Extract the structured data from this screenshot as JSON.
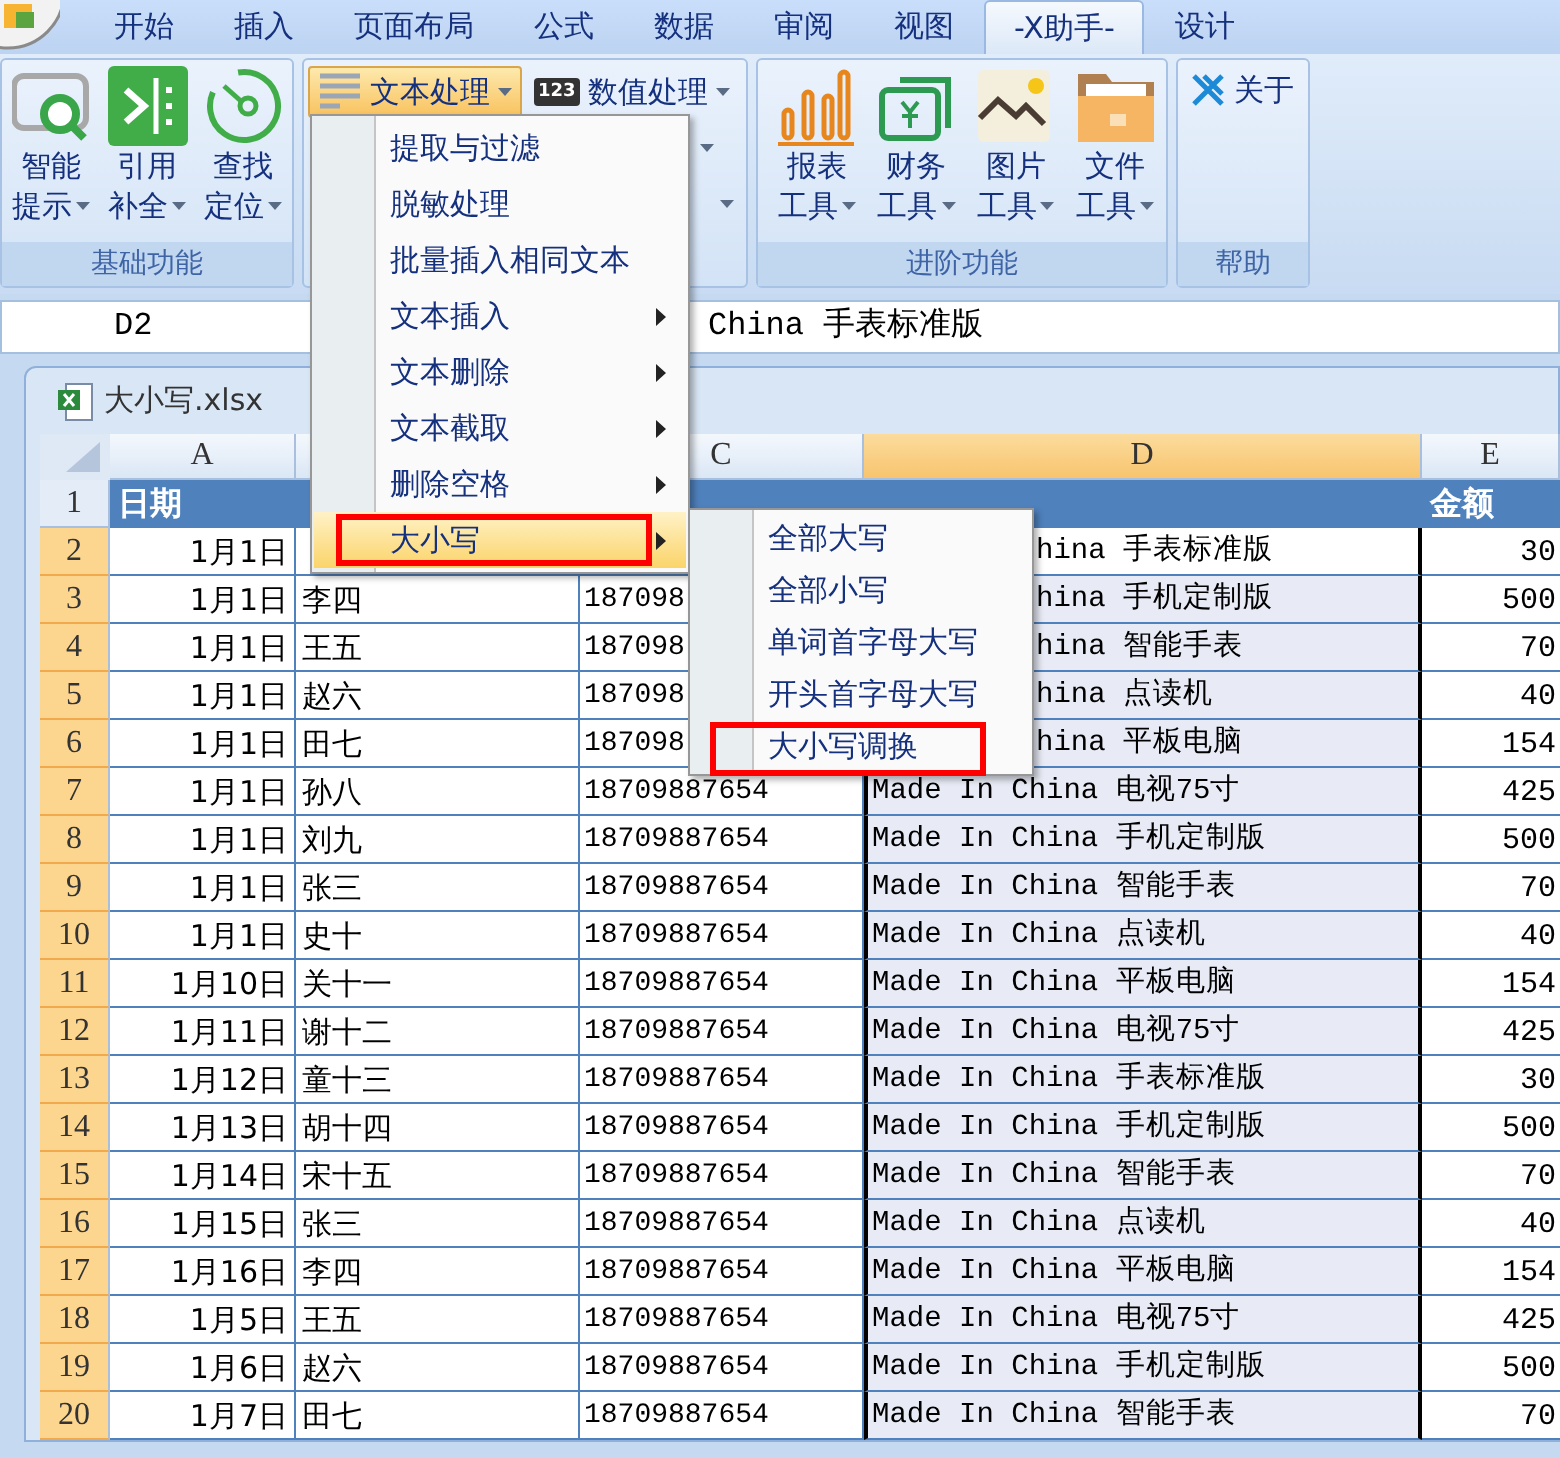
{
  "tabs": [
    {
      "label": "开始",
      "selected": false
    },
    {
      "label": "插入",
      "selected": false
    },
    {
      "label": "页面布局",
      "selected": false
    },
    {
      "label": "公式",
      "selected": false
    },
    {
      "label": "数据",
      "selected": false
    },
    {
      "label": "审阅",
      "selected": false
    },
    {
      "label": "视图",
      "selected": false
    },
    {
      "label": "-X助手-",
      "selected": true
    },
    {
      "label": "设计",
      "selected": false
    }
  ],
  "ribbon": {
    "basic": {
      "label": "基础功能",
      "buttons": [
        {
          "top": "智能",
          "bottom": "提示"
        },
        {
          "top": "引用",
          "bottom": "补全"
        },
        {
          "top": "查找",
          "bottom": "定位"
        }
      ]
    },
    "text_group": {
      "buttons": [
        {
          "label": "文本处理",
          "pressed": true
        },
        {
          "label": "数值处理",
          "pressed": false,
          "badge": "123"
        }
      ]
    },
    "advanced": {
      "label": "进阶功能",
      "buttons": [
        {
          "top": "报表",
          "bottom": "工具"
        },
        {
          "top": "财务",
          "bottom": "工具"
        },
        {
          "top": "图片",
          "bottom": "工具"
        },
        {
          "top": "文件",
          "bottom": "工具"
        }
      ]
    },
    "help": {
      "label": "帮助",
      "button": "关于"
    }
  },
  "formula_bar": {
    "name_box": "D2",
    "formula": "China 手表标准版"
  },
  "sheet": {
    "title": "大小写.xlsx",
    "columns": [
      {
        "letter": "A",
        "selected": false
      },
      {
        "letter": "C",
        "selected": false
      },
      {
        "letter": "D",
        "selected": true
      },
      {
        "letter": "E",
        "selected": false
      }
    ],
    "header": {
      "number": "1",
      "selected": false,
      "date": "日期",
      "amount": "金额"
    },
    "rows": [
      {
        "number": "2",
        "selected": true,
        "active": true,
        "date": "1月1日",
        "product": "hina 手表标准版",
        "amount": "30"
      },
      {
        "number": "3",
        "selected": true,
        "active": false,
        "date": "1月1日",
        "name": "李四",
        "phone": "187098",
        "product": "hina 手机定制版",
        "amount": "500"
      },
      {
        "number": "4",
        "selected": true,
        "active": false,
        "date": "1月1日",
        "name": "王五",
        "phone": "187098",
        "product": "hina 智能手表",
        "amount": "70"
      },
      {
        "number": "5",
        "selected": true,
        "active": false,
        "date": "1月1日",
        "name": "赵六",
        "phone": "187098",
        "product": "hina 点读机",
        "amount": "40"
      },
      {
        "number": "6",
        "selected": true,
        "active": false,
        "date": "1月1日",
        "name": "田七",
        "phone": "187098",
        "product": "hina 平板电脑",
        "amount": "154"
      },
      {
        "number": "7",
        "selected": true,
        "active": false,
        "date": "1月1日",
        "name": "孙八",
        "phone": "18709887654",
        "product": "Made In China 电视75寸",
        "amount": "425"
      },
      {
        "number": "8",
        "selected": true,
        "active": false,
        "date": "1月1日",
        "name": "刘九",
        "phone": "18709887654",
        "product": "Made In China 手机定制版",
        "amount": "500"
      },
      {
        "number": "9",
        "selected": true,
        "active": false,
        "date": "1月1日",
        "name": "张三",
        "phone": "18709887654",
        "product": "Made In China 智能手表",
        "amount": "70"
      },
      {
        "number": "10",
        "selected": true,
        "active": false,
        "date": "1月1日",
        "name": "史十",
        "phone": "18709887654",
        "product": "Made In China 点读机",
        "amount": "40"
      },
      {
        "number": "11",
        "selected": true,
        "active": false,
        "date": "1月10日",
        "name": "关十一",
        "phone": "18709887654",
        "product": "Made In China 平板电脑",
        "amount": "154"
      },
      {
        "number": "12",
        "selected": true,
        "active": false,
        "date": "1月11日",
        "name": "谢十二",
        "phone": "18709887654",
        "product": "Made In China 电视75寸",
        "amount": "425"
      },
      {
        "number": "13",
        "selected": true,
        "active": false,
        "date": "1月12日",
        "name": "童十三",
        "phone": "18709887654",
        "product": "Made In China 手表标准版",
        "amount": "30"
      },
      {
        "number": "14",
        "selected": true,
        "active": false,
        "date": "1月13日",
        "name": "胡十四",
        "phone": "18709887654",
        "product": "Made In China 手机定制版",
        "amount": "500"
      },
      {
        "number": "15",
        "selected": true,
        "active": false,
        "date": "1月14日",
        "name": "宋十五",
        "phone": "18709887654",
        "product": "Made In China 智能手表",
        "amount": "70"
      },
      {
        "number": "16",
        "selected": true,
        "active": false,
        "date": "1月15日",
        "name": "张三",
        "phone": "18709887654",
        "product": "Made In China 点读机",
        "amount": "40"
      },
      {
        "number": "17",
        "selected": true,
        "active": false,
        "date": "1月16日",
        "name": "李四",
        "phone": "18709887654",
        "product": "Made In China 平板电脑",
        "amount": "154"
      },
      {
        "number": "18",
        "selected": true,
        "active": false,
        "date": "1月5日",
        "name": "王五",
        "phone": "18709887654",
        "product": "Made In China 电视75寸",
        "amount": "425"
      },
      {
        "number": "19",
        "selected": true,
        "active": false,
        "date": "1月6日",
        "name": "赵六",
        "phone": "18709887654",
        "product": "Made In China 手机定制版",
        "amount": "500"
      },
      {
        "number": "20",
        "selected": true,
        "active": false,
        "date": "1月7日",
        "name": "田七",
        "phone": "18709887654",
        "product": "Made In China 智能手表",
        "amount": "70"
      }
    ]
  },
  "menu": {
    "items": [
      {
        "label": "提取与过滤",
        "submenu": false,
        "selected": false,
        "outlined": false
      },
      {
        "label": "脱敏处理",
        "submenu": false,
        "selected": false,
        "outlined": false
      },
      {
        "label": "批量插入相同文本",
        "submenu": false,
        "selected": false,
        "outlined": false
      },
      {
        "label": "文本插入",
        "submenu": true,
        "selected": false,
        "outlined": false
      },
      {
        "label": "文本删除",
        "submenu": true,
        "selected": false,
        "outlined": false
      },
      {
        "label": "文本截取",
        "submenu": true,
        "selected": false,
        "outlined": false
      },
      {
        "label": "删除空格",
        "submenu": true,
        "selected": false,
        "outlined": false
      },
      {
        "label": "大小写",
        "submenu": true,
        "selected": true,
        "outlined": true
      }
    ],
    "submenu": [
      {
        "label": "全部大写",
        "outlined": false
      },
      {
        "label": "全部小写",
        "outlined": false
      },
      {
        "label": "单词首字母大写",
        "outlined": false
      },
      {
        "label": "开头首字母大写",
        "outlined": false
      },
      {
        "label": "大小写调换",
        "outlined": true
      }
    ]
  }
}
